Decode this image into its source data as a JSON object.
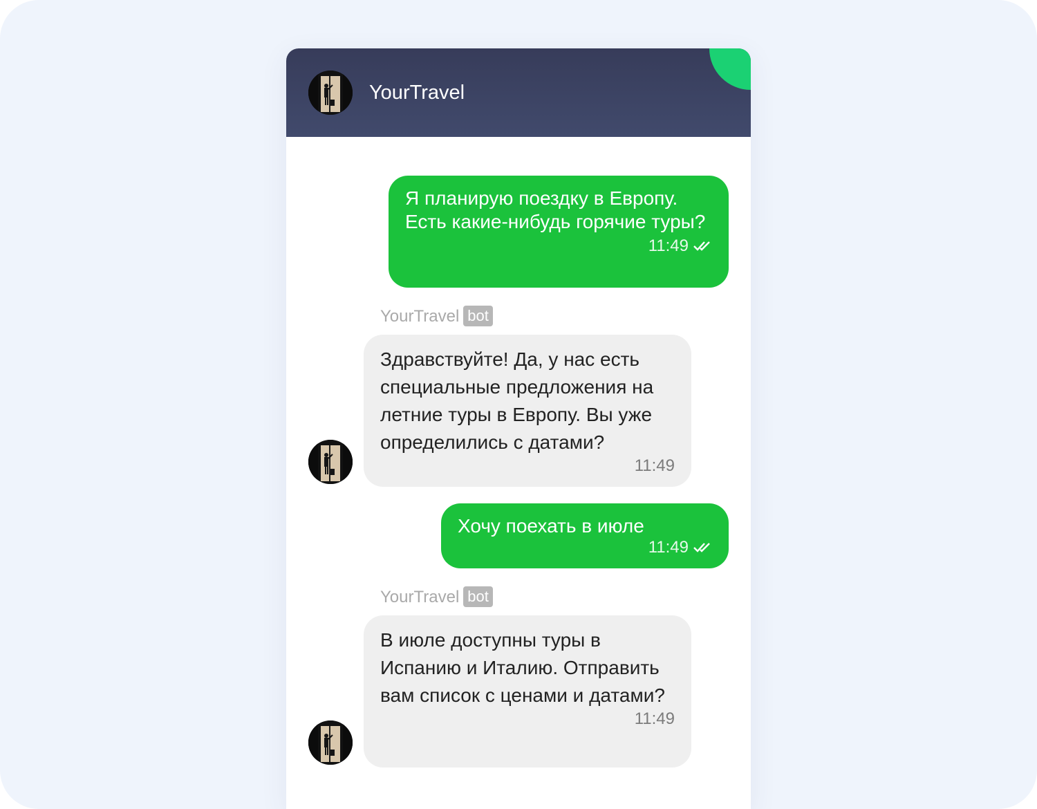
{
  "header": {
    "title": "YourTravel",
    "avatar_icon": "traveler-photo-icon",
    "accent_color": "#1bd173"
  },
  "messages": [
    {
      "direction": "outgoing",
      "text": "Я планирую поездку в Европу. Есть какие-нибудь горячие туры?",
      "time": "11:49",
      "status_icon": "double-check-icon"
    },
    {
      "direction": "incoming",
      "sender": "YourTravel",
      "badge": "bot",
      "text": "Здравствуйте! Да, у нас есть специальные предложения на летние туры в Европу. Вы уже определились с датами?",
      "time": "11:49"
    },
    {
      "direction": "outgoing",
      "text": "Хочу поехать в июле",
      "time": "11:49",
      "status_icon": "double-check-icon"
    },
    {
      "direction": "incoming",
      "sender": "YourTravel",
      "badge": "bot",
      "text": "В июле доступны туры в Испанию и Италию. Отправить вам список с ценами и датами?",
      "time": "11:49"
    }
  ],
  "colors": {
    "outgoing_bubble": "#1bc23c",
    "incoming_bubble": "#efefef",
    "header_bg": "#3b4262",
    "page_bg": "#eff4fc"
  }
}
